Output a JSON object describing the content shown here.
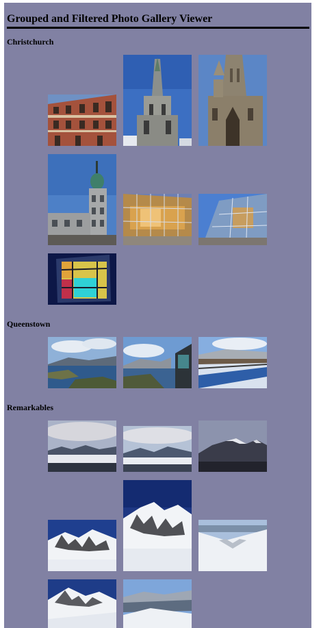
{
  "header": {
    "title": "Grouped and Filtered Photo Gallery Viewer"
  },
  "groups": [
    {
      "name": "Christchurch",
      "photos": [
        {
          "subject": "brick-facade"
        },
        {
          "subject": "cathedral-spire"
        },
        {
          "subject": "stone-gothic-tower"
        },
        {
          "subject": "green-dome-building"
        },
        {
          "subject": "glass-facade-warm"
        },
        {
          "subject": "glass-facade-blue"
        },
        {
          "subject": "stained-glass-window"
        }
      ]
    },
    {
      "name": "Queenstown",
      "photos": [
        {
          "subject": "lake-panorama"
        },
        {
          "subject": "gondola-viewpoint"
        },
        {
          "subject": "snowy-waterfront"
        }
      ]
    },
    {
      "name": "Remarkables",
      "photos": [
        {
          "subject": "cloudy-range-1"
        },
        {
          "subject": "cloudy-range-2"
        },
        {
          "subject": "dark-mountains"
        },
        {
          "subject": "snow-peaks-1"
        },
        {
          "subject": "snow-peak-tall"
        },
        {
          "subject": "snow-valley"
        },
        {
          "subject": "snow-slope"
        },
        {
          "subject": "alpine-vista"
        }
      ]
    }
  ]
}
